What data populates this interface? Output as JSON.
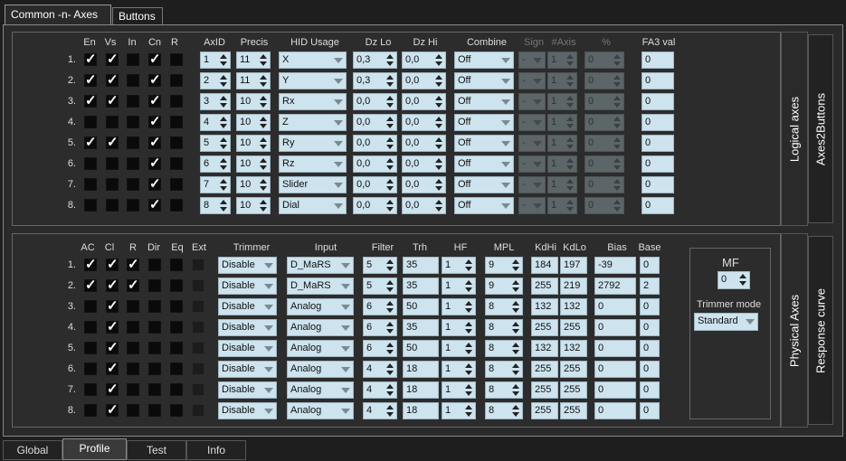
{
  "top_tabs": [
    {
      "label": "Common -n- Axes"
    },
    {
      "label": "Buttons"
    }
  ],
  "bottom_tabs": [
    {
      "label": "Global"
    },
    {
      "label": "Profile"
    },
    {
      "label": "Test"
    },
    {
      "label": "Info"
    }
  ],
  "logical": {
    "side_tab": "Logical axes",
    "side_tab2": "Axes2Buttons",
    "headers": {
      "en": "En",
      "vs": "Vs",
      "in": "In",
      "cn": "Cn",
      "r": "R",
      "axid": "AxID",
      "precis": "Precis",
      "hid": "HID Usage",
      "dzlo": "Dz Lo",
      "dzhi": "Dz Hi",
      "combine": "Combine",
      "sign": "Sign",
      "naxis": "#Axis",
      "pct": "%",
      "fa3": "FA3 val"
    },
    "rows": [
      {
        "num": "1.",
        "en": true,
        "vs": true,
        "in": false,
        "cn": true,
        "r": false,
        "axid": "1",
        "precis": "11",
        "hid": "X",
        "dzlo": "0,3",
        "dzhi": "0,0",
        "combine": "Off",
        "sign": "-",
        "naxis": "1",
        "pct": "0",
        "fa3": "0"
      },
      {
        "num": "2.",
        "en": true,
        "vs": true,
        "in": false,
        "cn": true,
        "r": false,
        "axid": "2",
        "precis": "11",
        "hid": "Y",
        "dzlo": "0,3",
        "dzhi": "0,0",
        "combine": "Off",
        "sign": "-",
        "naxis": "1",
        "pct": "0",
        "fa3": "0"
      },
      {
        "num": "3.",
        "en": true,
        "vs": true,
        "in": false,
        "cn": true,
        "r": false,
        "axid": "3",
        "precis": "10",
        "hid": "Rx",
        "dzlo": "0,0",
        "dzhi": "0,0",
        "combine": "Off",
        "sign": "-",
        "naxis": "1",
        "pct": "0",
        "fa3": "0"
      },
      {
        "num": "4.",
        "en": false,
        "vs": false,
        "in": false,
        "cn": true,
        "r": false,
        "axid": "4",
        "precis": "10",
        "hid": "Z",
        "dzlo": "0,0",
        "dzhi": "0,0",
        "combine": "Off",
        "sign": "-",
        "naxis": "1",
        "pct": "0",
        "fa3": "0"
      },
      {
        "num": "5.",
        "en": true,
        "vs": true,
        "in": false,
        "cn": true,
        "r": false,
        "axid": "5",
        "precis": "10",
        "hid": "Ry",
        "dzlo": "0,0",
        "dzhi": "0,0",
        "combine": "Off",
        "sign": "-",
        "naxis": "1",
        "pct": "0",
        "fa3": "0"
      },
      {
        "num": "6.",
        "en": false,
        "vs": false,
        "in": false,
        "cn": true,
        "r": false,
        "axid": "6",
        "precis": "10",
        "hid": "Rz",
        "dzlo": "0,0",
        "dzhi": "0,0",
        "combine": "Off",
        "sign": "-",
        "naxis": "1",
        "pct": "0",
        "fa3": "0"
      },
      {
        "num": "7.",
        "en": false,
        "vs": false,
        "in": false,
        "cn": true,
        "r": false,
        "axid": "7",
        "precis": "10",
        "hid": "Slider",
        "dzlo": "0,0",
        "dzhi": "0,0",
        "combine": "Off",
        "sign": "-",
        "naxis": "1",
        "pct": "0",
        "fa3": "0"
      },
      {
        "num": "8.",
        "en": false,
        "vs": false,
        "in": false,
        "cn": true,
        "r": false,
        "axid": "8",
        "precis": "10",
        "hid": "Dial",
        "dzlo": "0,0",
        "dzhi": "0,0",
        "combine": "Off",
        "sign": "-",
        "naxis": "1",
        "pct": "0",
        "fa3": "0"
      }
    ]
  },
  "physical": {
    "side_tab": "Physical Axes",
    "side_tab2": "Response curve",
    "headers": {
      "ac": "AC",
      "cl": "Cl",
      "r": "R",
      "dir": "Dir",
      "eq": "Eq",
      "ext": "Ext",
      "trimmer": "Trimmer",
      "input": "Input",
      "filter": "Filter",
      "trh": "Trh",
      "hf": "HF",
      "mpl": "MPL",
      "kdhi": "KdHi",
      "kdlo": "KdLo",
      "bias": "Bias",
      "base": "Base"
    },
    "rows": [
      {
        "num": "1.",
        "ac": true,
        "cl": true,
        "r": true,
        "dir": false,
        "eq": false,
        "trimmer": "Disable",
        "input": "D_MaRS",
        "filter": "5",
        "trh": "35",
        "hf": "1",
        "mpl": "9",
        "kdhi": "184",
        "kdlo": "197",
        "bias": "-39",
        "base": "0"
      },
      {
        "num": "2.",
        "ac": true,
        "cl": true,
        "r": true,
        "dir": false,
        "eq": false,
        "trimmer": "Disable",
        "input": "D_MaRS",
        "filter": "5",
        "trh": "35",
        "hf": "1",
        "mpl": "9",
        "kdhi": "255",
        "kdlo": "219",
        "bias": "2792",
        "base": "2"
      },
      {
        "num": "3.",
        "ac": false,
        "cl": true,
        "r": false,
        "dir": false,
        "eq": false,
        "trimmer": "Disable",
        "input": "Analog",
        "filter": "6",
        "trh": "50",
        "hf": "1",
        "mpl": "8",
        "kdhi": "132",
        "kdlo": "132",
        "bias": "0",
        "base": "0"
      },
      {
        "num": "4.",
        "ac": false,
        "cl": true,
        "r": false,
        "dir": false,
        "eq": false,
        "trimmer": "Disable",
        "input": "Analog",
        "filter": "6",
        "trh": "35",
        "hf": "1",
        "mpl": "8",
        "kdhi": "255",
        "kdlo": "255",
        "bias": "0",
        "base": "0"
      },
      {
        "num": "5.",
        "ac": false,
        "cl": true,
        "r": false,
        "dir": false,
        "eq": false,
        "trimmer": "Disable",
        "input": "Analog",
        "filter": "6",
        "trh": "50",
        "hf": "1",
        "mpl": "8",
        "kdhi": "132",
        "kdlo": "132",
        "bias": "0",
        "base": "0"
      },
      {
        "num": "6.",
        "ac": false,
        "cl": true,
        "r": false,
        "dir": false,
        "eq": false,
        "trimmer": "Disable",
        "input": "Analog",
        "filter": "4",
        "trh": "18",
        "hf": "1",
        "mpl": "8",
        "kdhi": "255",
        "kdlo": "255",
        "bias": "0",
        "base": "0"
      },
      {
        "num": "7.",
        "ac": false,
        "cl": true,
        "r": false,
        "dir": false,
        "eq": false,
        "trimmer": "Disable",
        "input": "Analog",
        "filter": "4",
        "trh": "18",
        "hf": "1",
        "mpl": "8",
        "kdhi": "255",
        "kdlo": "255",
        "bias": "0",
        "base": "0"
      },
      {
        "num": "8.",
        "ac": false,
        "cl": true,
        "r": false,
        "dir": false,
        "eq": false,
        "trimmer": "Disable",
        "input": "Analog",
        "filter": "4",
        "trh": "18",
        "hf": "1",
        "mpl": "8",
        "kdhi": "255",
        "kdlo": "255",
        "bias": "0",
        "base": "0"
      }
    ]
  },
  "mf": {
    "label": "MF",
    "value": "0",
    "trimmer_mode_label": "Trimmer mode",
    "trimmer_mode": "Standard"
  },
  "colors": {
    "field_bg": "#cde3ee",
    "field_disabled": "#5c6568",
    "bg": "#2a2a2a"
  }
}
